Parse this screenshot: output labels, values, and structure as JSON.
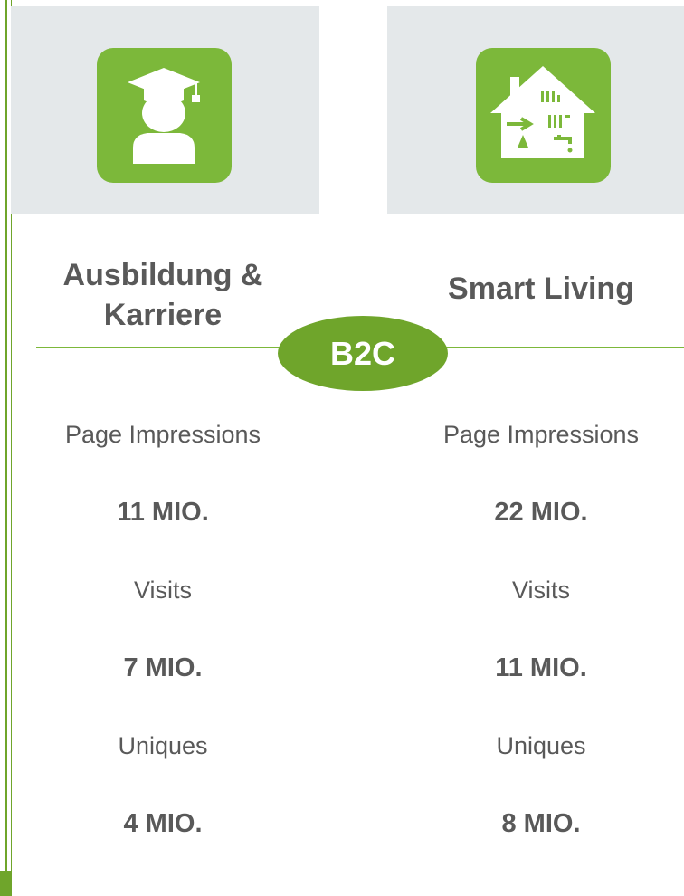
{
  "categories": [
    {
      "heading_line1": "Ausbildung &",
      "heading_line2": "Karriere",
      "icon": "graduate-icon",
      "stats": [
        {
          "label": "Page Impressions",
          "value": "11 MIO."
        },
        {
          "label": "Visits",
          "value": "7 MIO."
        },
        {
          "label": "Uniques",
          "value": "4 MIO."
        }
      ]
    },
    {
      "heading": "Smart Living",
      "icon": "smart-house-icon",
      "stats": [
        {
          "label": "Page Impressions",
          "value": "22 MIO."
        },
        {
          "label": "Visits",
          "value": "11 MIO."
        },
        {
          "label": "Uniques",
          "value": "8 MIO."
        }
      ]
    }
  ],
  "badge": "B2C",
  "colors": {
    "accent": "#7cb83a",
    "accent_dark": "#6fa52b",
    "panel": "#e4e8ea",
    "text": "#595959"
  }
}
